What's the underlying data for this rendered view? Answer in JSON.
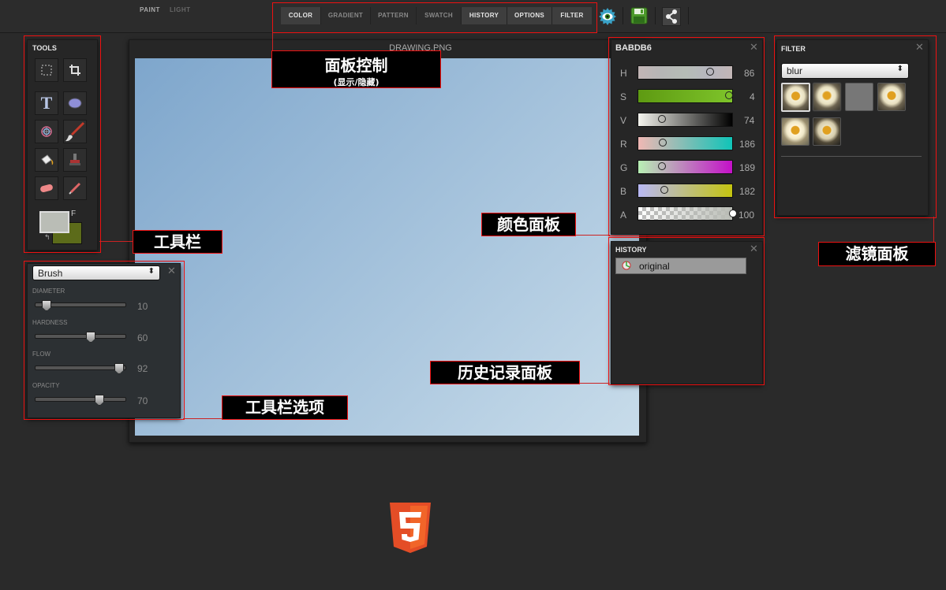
{
  "header": {
    "modes": [
      "PAINT",
      "LIGHT"
    ],
    "tabs": [
      "COLOR",
      "GRADIENT",
      "PATTERN",
      "SWATCH",
      "HISTORY",
      "OPTIONS",
      "FILTER"
    ],
    "active_tabs": [
      "COLOR",
      "HISTORY",
      "OPTIONS",
      "FILTER"
    ],
    "icons": [
      "eye-icon",
      "save-icon",
      "share-icon"
    ]
  },
  "tools": {
    "title": "TOOLS",
    "icons": [
      "marquee-icon",
      "crop-icon",
      "text-icon",
      "ellipse-icon",
      "spirograph-icon",
      "brush-icon",
      "fill-bucket-icon",
      "stamp-icon",
      "eraser-icon",
      "eyedropper-icon"
    ],
    "fg_bg_label": "F",
    "primary_color": "#BABDB6",
    "secondary_color": "#5c6b1a"
  },
  "options": {
    "tool_select": "Brush",
    "sliders": [
      {
        "label": "DIAMETER",
        "value": 10
      },
      {
        "label": "HARDNESS",
        "value": 60
      },
      {
        "label": "FLOW",
        "value": 92
      },
      {
        "label": "OPACITY",
        "value": 70
      }
    ]
  },
  "canvas": {
    "title": "DRAWING.PNG",
    "gradient_start": "#7ea6cc",
    "gradient_end": "#c8dcea"
  },
  "color": {
    "title": "BABDB6",
    "channels": [
      {
        "label": "H",
        "value": 86,
        "max": 100
      },
      {
        "label": "S",
        "value": 4,
        "max": 4
      },
      {
        "label": "V",
        "value": 74,
        "max": 320
      },
      {
        "label": "R",
        "value": 186,
        "max": 1000
      },
      {
        "label": "G",
        "value": 189,
        "max": 1000
      },
      {
        "label": "B",
        "value": 182,
        "max": 900
      },
      {
        "label": "A",
        "value": 100,
        "max": 100
      }
    ]
  },
  "history": {
    "title": "HISTORY",
    "items": [
      "original"
    ]
  },
  "filter": {
    "title": "FILTER",
    "select": "blur",
    "thumb_count": 6
  },
  "annotations": {
    "panel_control": "面板控制",
    "panel_control_sub": "(显示/隐藏)",
    "toolbar": "工具栏",
    "toolbar_options": "工具栏选项",
    "color_panel": "颜色面板",
    "history_panel": "历史记录面板",
    "filter_panel": "滤镜面板"
  },
  "colors": {
    "annotation_red": "#ee1111",
    "html5_orange": "#e44d26"
  }
}
